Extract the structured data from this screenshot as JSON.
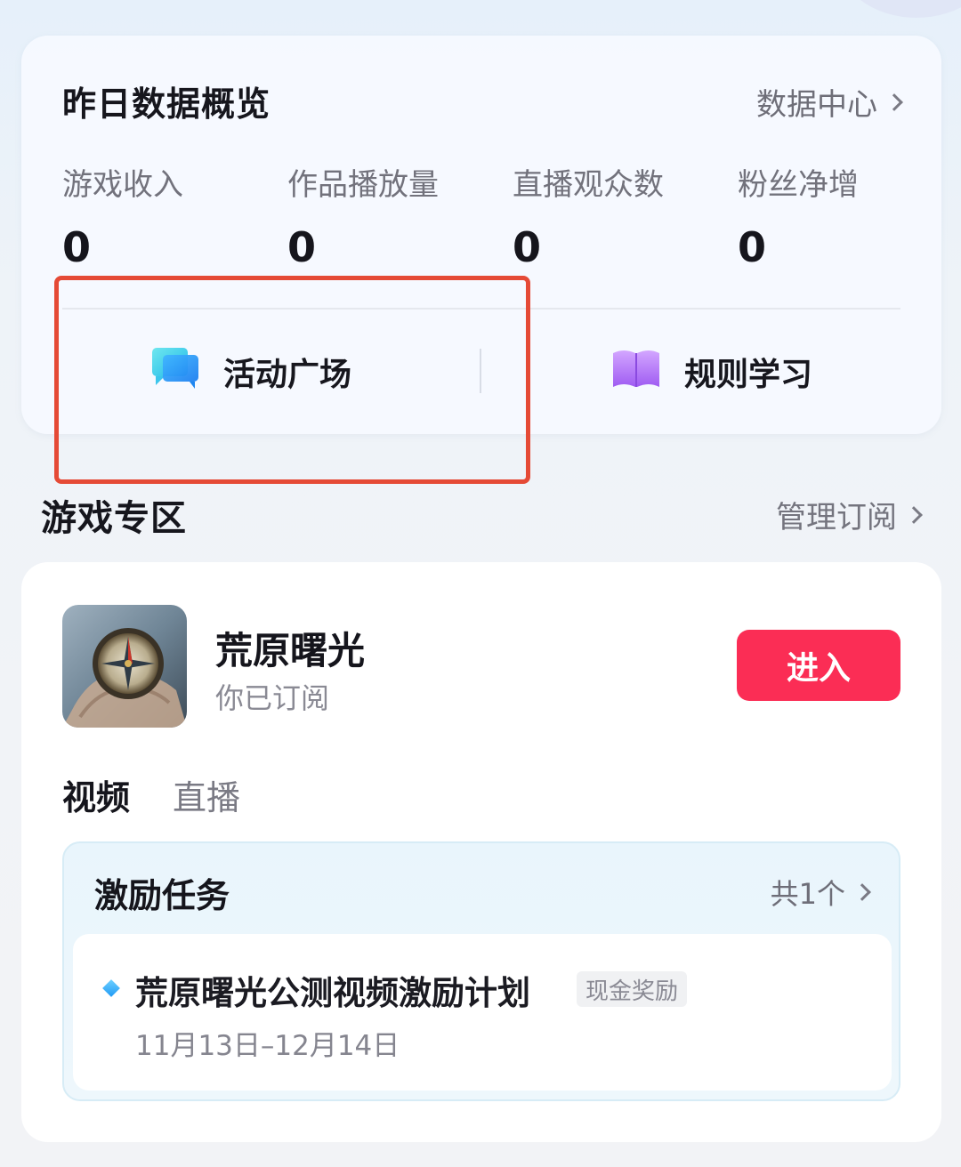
{
  "overview": {
    "title": "昨日数据概览",
    "link_label": "数据中心",
    "stats": [
      {
        "label": "游戏收入",
        "value": "0"
      },
      {
        "label": "作品播放量",
        "value": "0"
      },
      {
        "label": "直播观众数",
        "value": "0"
      },
      {
        "label": "粉丝净增",
        "value": "0"
      }
    ],
    "quick_links": [
      {
        "label": "活动广场",
        "icon": "chat-bubble-icon"
      },
      {
        "label": "规则学习",
        "icon": "book-icon"
      }
    ]
  },
  "section": {
    "title": "游戏专区",
    "link_label": "管理订阅"
  },
  "game": {
    "name": "荒原曙光",
    "subtitle": "你已订阅",
    "enter_label": "进入",
    "icon": "compass-icon",
    "tabs": [
      {
        "label": "视频",
        "active": true
      },
      {
        "label": "直播",
        "active": false
      }
    ],
    "tasks": {
      "title": "激励任务",
      "count_label": "共1个",
      "items": [
        {
          "name": "荒原曙光公测视频激励计划",
          "badge": "现金奖励",
          "date": "11月13日–12月14日"
        }
      ]
    }
  },
  "colors": {
    "accent": "#fb2d55",
    "highlight": "#e54a36"
  }
}
